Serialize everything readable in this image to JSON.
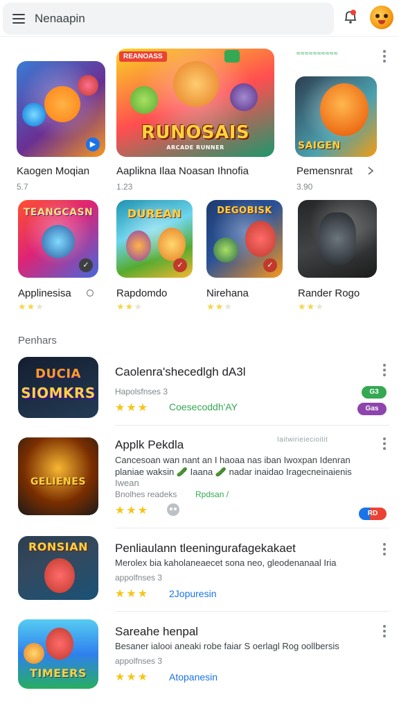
{
  "header": {
    "search_text": "Nenaapin",
    "menu_icon": "hamburger-icon",
    "notification_icon": "bell-notification-icon",
    "avatar_icon": "user-avatar-icon"
  },
  "top_section": {
    "small_header": "≈≈≈≈≈≈≈≈≈≈",
    "cards": [
      {
        "title": "Kaogen Moqian",
        "sub": "5.7"
      },
      {
        "title": "Aaplikna Ilaa Noasan Ihnofia",
        "sub": "1.23",
        "art_text": "RUNOSAIS",
        "art_top": "REANOASS",
        "art_bottom": "ARCADE RUNNER"
      },
      {
        "title": "Pemensnrat",
        "sub": "3.90",
        "art_text": "SAIGEN"
      }
    ]
  },
  "second_row": {
    "cards": [
      {
        "title": "Applinesisa",
        "art_text": "TEANGCASN"
      },
      {
        "title": "Rapdomdo",
        "art_text": "DUREAN"
      },
      {
        "title": "Nirehana",
        "art_text": "DEGOBISK"
      },
      {
        "title": "Rander Rogo"
      }
    ]
  },
  "section_label": "Penhars",
  "list": [
    {
      "title": "Caolenra'shecedlgh dA3l",
      "meta": "Hapolsfnses 3",
      "link": "Coesecoddh'AY",
      "link_color": "#34a853",
      "art_text": "SIOMKRS",
      "art_top": "DUCIA",
      "pill1": "G3",
      "pill2": "Gas"
    },
    {
      "title": "Applk Pekdla",
      "desc1": "Cancesoan wan nant an I haoaa nas iban Iwoxpan Idenran",
      "desc2": "planiae waksin 🥒 Iaana 🥒 nadar inaidao Iragecneinaienis",
      "desc3": "Iwean",
      "meta": "Bnolhes readeks",
      "link": "Rpdsan /",
      "link_color": "#34a853",
      "art_text": "GELIENES",
      "small_header": "Iaitwirieiecioitit",
      "pill": "RD"
    },
    {
      "title": "Penliaulann tleeningurafagekakaet",
      "desc1": "Merolex bia kaholaneaecet sona neo, gleodenanaal Iria",
      "meta": "appolfnses 3",
      "link": "2Jopuresin",
      "link_color": "#1a73e8",
      "art_text": "RONSIAN"
    },
    {
      "title": "Sareahe henpal",
      "desc1": "Besaner ialooi aneaki robe faiar S oerlagl Rog oollbersis",
      "meta": "appolfnses 3",
      "link": "Atopanesin",
      "link_color": "#1a73e8",
      "art_text": "TIMEERS"
    }
  ],
  "colors": {
    "accent_blue": "#1a73e8",
    "accent_green": "#34a853",
    "star": "#f5c518"
  }
}
